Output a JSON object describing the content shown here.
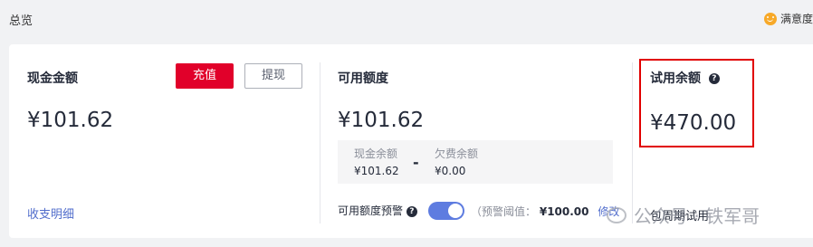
{
  "header": {
    "title": "总览",
    "satisfaction_label": "满意度"
  },
  "cash": {
    "title": "现金金额",
    "amount": "¥101.62",
    "recharge_label": "充值",
    "withdraw_label": "提现",
    "details_link": "收支明细"
  },
  "available": {
    "title": "可用额度",
    "amount": "¥101.62",
    "cash_balance_label": "现金余额",
    "cash_balance_value": "¥101.62",
    "separator": "-",
    "arrears_label": "欠费余额",
    "arrears_value": "¥0.00",
    "alert_label": "可用额度预警",
    "alert_enabled": true,
    "threshold_label": "（预警阈值：",
    "threshold_value": "¥100.00",
    "modify_link": "修改"
  },
  "trial": {
    "title": "试用余额",
    "amount": "¥470.00",
    "package_link": "包周期试用"
  },
  "watermark": {
    "text": "公众号 · 铁军哥"
  },
  "colors": {
    "accent_red": "#e1002a",
    "link_blue": "#526ecc",
    "toggle_blue": "#5e7ce0",
    "highlight_red": "#e10000"
  },
  "icons": [
    "smile-icon",
    "help-icon",
    "wechat-icon"
  ]
}
